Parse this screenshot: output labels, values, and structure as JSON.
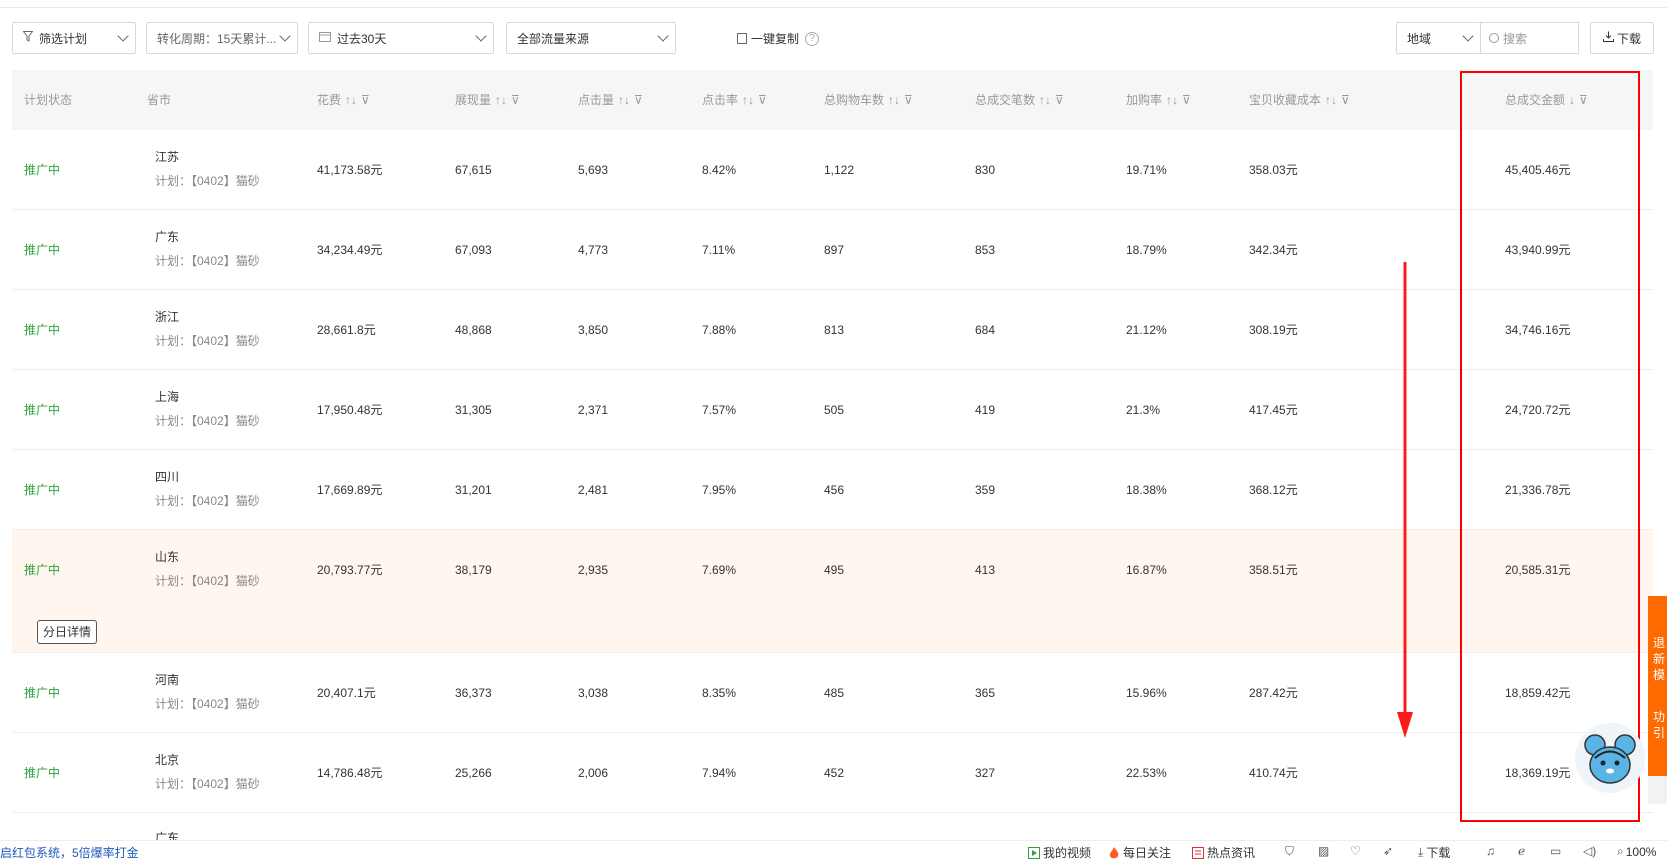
{
  "toolbar": {
    "filter_plan": "筛选计划",
    "conversion_period": "转化周期：15天累计...",
    "date_range": "过去30天",
    "traffic_source": "全部流量来源",
    "copy_label": "一键复制",
    "help": "?",
    "region": "地域",
    "search_placeholder": "搜索",
    "download": "下载"
  },
  "table": {
    "columns": [
      "计划状态",
      "省市",
      "花费",
      "展现量",
      "点击量",
      "点击率",
      "总购物车数",
      "总成交笔数",
      "加购率",
      "宝贝收藏成本",
      "总成交金额"
    ],
    "sort_glyph": "↑↓",
    "desc_glyph": "↓",
    "filter_glyph": "⊽",
    "detail_button": "分日详情",
    "rows": [
      {
        "status": "推广中",
        "province": "江苏",
        "plan": "计划：【0402】猫砂",
        "cost": "41,173.58元",
        "impressions": "67,615",
        "clicks": "5,693",
        "ctr": "8.42%",
        "carts": "1,122",
        "orders": "830",
        "cart_rate": "19.71%",
        "fav_cost": "358.03元",
        "gmv": "45,405.46元"
      },
      {
        "status": "推广中",
        "province": "广东",
        "plan": "计划：【0402】猫砂",
        "cost": "34,234.49元",
        "impressions": "67,093",
        "clicks": "4,773",
        "ctr": "7.11%",
        "carts": "897",
        "orders": "853",
        "cart_rate": "18.79%",
        "fav_cost": "342.34元",
        "gmv": "43,940.99元"
      },
      {
        "status": "推广中",
        "province": "浙江",
        "plan": "计划：【0402】猫砂",
        "cost": "28,661.8元",
        "impressions": "48,868",
        "clicks": "3,850",
        "ctr": "7.88%",
        "carts": "813",
        "orders": "684",
        "cart_rate": "21.12%",
        "fav_cost": "308.19元",
        "gmv": "34,746.16元"
      },
      {
        "status": "推广中",
        "province": "上海",
        "plan": "计划：【0402】猫砂",
        "cost": "17,950.48元",
        "impressions": "31,305",
        "clicks": "2,371",
        "ctr": "7.57%",
        "carts": "505",
        "orders": "419",
        "cart_rate": "21.3%",
        "fav_cost": "417.45元",
        "gmv": "24,720.72元"
      },
      {
        "status": "推广中",
        "province": "四川",
        "plan": "计划：【0402】猫砂",
        "cost": "17,669.89元",
        "impressions": "31,201",
        "clicks": "2,481",
        "ctr": "7.95%",
        "carts": "456",
        "orders": "359",
        "cart_rate": "18.38%",
        "fav_cost": "368.12元",
        "gmv": "21,336.78元"
      },
      {
        "status": "推广中",
        "province": "山东",
        "plan": "计划：【0402】猫砂",
        "cost": "20,793.77元",
        "impressions": "38,179",
        "clicks": "2,935",
        "ctr": "7.69%",
        "carts": "495",
        "orders": "413",
        "cart_rate": "16.87%",
        "fav_cost": "358.51元",
        "gmv": "20,585.31元"
      },
      {
        "status": "推广中",
        "province": "河南",
        "plan": "计划：【0402】猫砂",
        "cost": "20,407.1元",
        "impressions": "36,373",
        "clicks": "3,038",
        "ctr": "8.35%",
        "carts": "485",
        "orders": "365",
        "cart_rate": "15.96%",
        "fav_cost": "287.42元",
        "gmv": "18,859.42元"
      },
      {
        "status": "推广中",
        "province": "北京",
        "plan": "计划：【0402】猫砂",
        "cost": "14,786.48元",
        "impressions": "25,266",
        "clicks": "2,006",
        "ctr": "7.94%",
        "carts": "452",
        "orders": "327",
        "cart_rate": "22.53%",
        "fav_cost": "410.74元",
        "gmv": "18,369.19元"
      }
    ],
    "partial_row_province": "广东"
  },
  "statusbar": {
    "left_text": "启红包系统，5倍爆率打金",
    "my_video": "我的视频",
    "daily_follow": "每日关注",
    "hot_news": "热点资讯",
    "download": "下载",
    "zoom": "100%"
  },
  "side_widget": {
    "line1": "退",
    "line2": "新",
    "line3": "模",
    "line4": "功",
    "line5": "引"
  },
  "colors": {
    "accent_green": "#2ea043",
    "annotation_red": "#ff0000",
    "highlight_row": "#fff6ef",
    "widget_orange": "#ff6a00"
  }
}
